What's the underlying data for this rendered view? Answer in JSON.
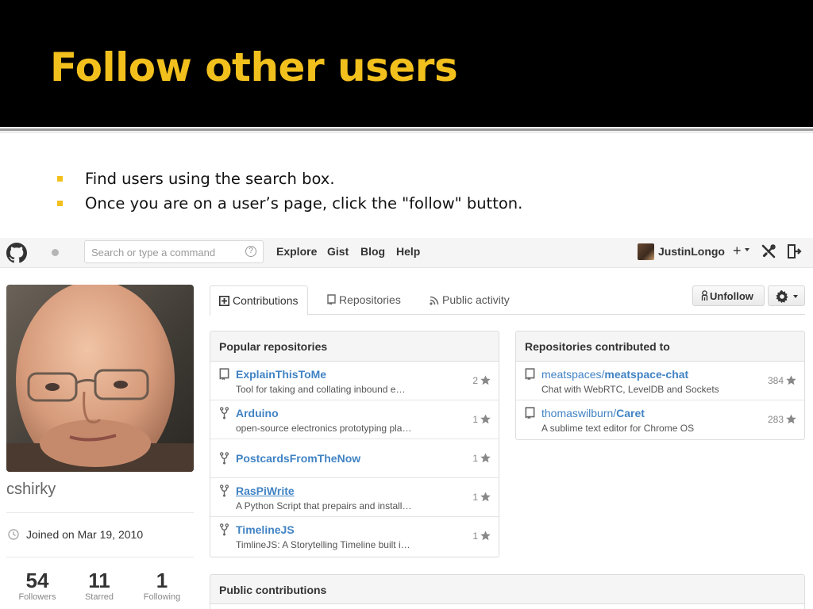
{
  "slide": {
    "title": "Follow other users",
    "bullets": [
      "Find users using the search box.",
      "Once you are on a user’s page, click the \"follow\" button."
    ]
  },
  "header": {
    "search_placeholder": "Search or type a command",
    "search_help": "?",
    "nav": [
      "Explore",
      "Gist",
      "Blog",
      "Help"
    ],
    "username": "JustinLongo",
    "plus": "+"
  },
  "profile": {
    "name": "cshirky",
    "joined": "Joined on Mar 19, 2010",
    "stats": [
      {
        "value": "54",
        "label": "Followers"
      },
      {
        "value": "11",
        "label": "Starred"
      },
      {
        "value": "1",
        "label": "Following"
      }
    ]
  },
  "tabs": [
    {
      "label": "Contributions",
      "icon": "contributions-icon",
      "selected": true
    },
    {
      "label": "Repositories",
      "icon": "repo-icon",
      "selected": false
    },
    {
      "label": "Public activity",
      "icon": "rss-icon",
      "selected": false
    }
  ],
  "actions": {
    "unfollow_label": "Unfollow"
  },
  "popular": {
    "title": "Popular repositories",
    "repos": [
      {
        "name": "ExplainThisToMe",
        "desc": "Tool for taking and collating inbound e…",
        "stars": "2",
        "icon": "repo-icon"
      },
      {
        "name": "Arduino",
        "desc": "open-source electronics prototyping pla…",
        "stars": "1",
        "icon": "fork-icon"
      },
      {
        "name": "PostcardsFromTheNow",
        "desc": "",
        "stars": "1",
        "icon": "fork-icon"
      },
      {
        "name": "RasPiWrite",
        "desc": "A Python Script that prepairs and install…",
        "stars": "1",
        "icon": "fork-icon"
      },
      {
        "name": "TimelineJS",
        "desc": "TimlineJS: A Storytelling Timeline built i…",
        "stars": "1",
        "icon": "fork-icon"
      }
    ]
  },
  "contributed": {
    "title": "Repositories contributed to",
    "repos": [
      {
        "owner": "meatspaces/",
        "name": "meatspace-chat",
        "desc": "Chat with WebRTC, LevelDB and Sockets",
        "stars": "384",
        "icon": "repo-icon"
      },
      {
        "owner": "thomaswilburn/",
        "name": "Caret",
        "desc": "A sublime text editor for Chrome OS",
        "stars": "283",
        "icon": "repo-icon"
      }
    ]
  },
  "public_contributions": {
    "title": "Public contributions"
  },
  "colors": {
    "slide_accent": "#f2c01d",
    "link": "#4183c4",
    "title_bar": "#000000"
  }
}
